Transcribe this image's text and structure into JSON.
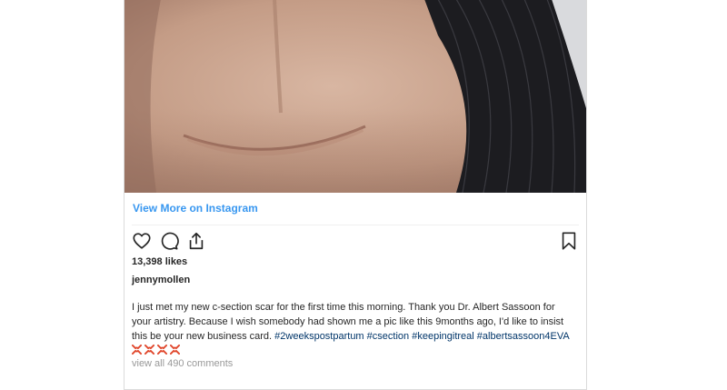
{
  "embed": {
    "view_more": "View More on Instagram",
    "likes": "13,398 likes",
    "username": "jennymollen",
    "caption": {
      "text": "I just met my new c-section scar for the first time this morning. Thank you Dr. Albert Sassoon for your artistry. Because I wish somebody had shown me a pic like this 9months ago, I'd like to insist this be your new business card.",
      "hashtags": [
        "#2weekspostpartum",
        "#csection",
        "#keepingitreal",
        "#albertsassoon4EVA"
      ],
      "emoji_name": "anger-symbol-emoji",
      "emoji_count": 4
    },
    "comments_link": "view all 490 comments",
    "icons": [
      "heart-icon",
      "comment-icon",
      "share-icon",
      "bookmark-icon"
    ],
    "colors": {
      "link_blue": "#3897f0",
      "hashtag": "#003569",
      "muted": "#999999",
      "text": "#262626"
    }
  }
}
